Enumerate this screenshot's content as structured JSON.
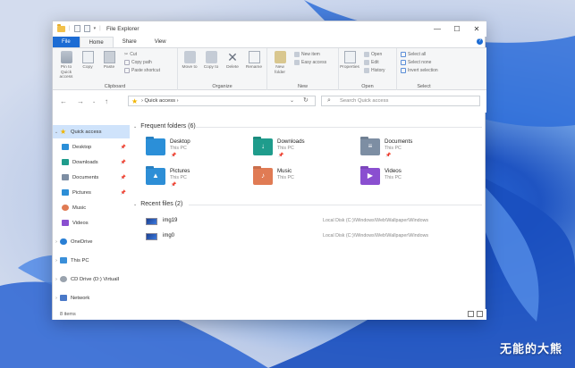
{
  "window": {
    "title": "File Explorer",
    "controls": {
      "minimize": "—",
      "maximize": "☐",
      "close": "✕"
    }
  },
  "tabs": [
    {
      "label": "File"
    },
    {
      "label": "Home"
    },
    {
      "label": "Share"
    },
    {
      "label": "View"
    }
  ],
  "help_label": "?",
  "ribbon": {
    "clipboard": {
      "label": "Clipboard",
      "pin": "Pin to Quick access",
      "copy": "Copy",
      "paste": "Paste",
      "cut": "Cut",
      "copy_path": "Copy path",
      "paste_shortcut": "Paste shortcut"
    },
    "organize": {
      "label": "Organize",
      "move_to": "Move to",
      "copy_to": "Copy to",
      "delete": "Delete",
      "rename": "Rename"
    },
    "new": {
      "label": "New",
      "new_folder": "New folder",
      "new_item": "New item",
      "easy_access": "Easy access"
    },
    "open": {
      "label": "Open",
      "properties": "Properties",
      "open": "Open",
      "edit": "Edit",
      "history": "History"
    },
    "select": {
      "label": "Select",
      "select_all": "Select all",
      "select_none": "Select none",
      "invert_selection": "Invert selection"
    }
  },
  "address": {
    "path": "Quick access",
    "search_placeholder": "Search Quick access"
  },
  "sidebar": {
    "items": [
      {
        "label": "Quick access"
      },
      {
        "label": "Desktop"
      },
      {
        "label": "Downloads"
      },
      {
        "label": "Documents"
      },
      {
        "label": "Pictures"
      },
      {
        "label": "Music"
      },
      {
        "label": "Videos"
      },
      {
        "label": "OneDrive"
      },
      {
        "label": "This PC"
      },
      {
        "label": "CD Drive (D:) VirtualI"
      },
      {
        "label": "Network"
      }
    ]
  },
  "frequent": {
    "header": "Frequent folders (6)",
    "folders": [
      {
        "name": "Desktop",
        "location": "This PC",
        "color": "#2b8fd8"
      },
      {
        "name": "Downloads",
        "location": "This PC",
        "color": "#1f9c8c"
      },
      {
        "name": "Documents",
        "location": "This PC",
        "color": "#7d8ea3"
      },
      {
        "name": "Pictures",
        "location": "This PC",
        "color": "#2d8ed6"
      },
      {
        "name": "Music",
        "location": "This PC",
        "color": "#e07b54"
      },
      {
        "name": "Videos",
        "location": "This PC",
        "color": "#8a4fd0"
      }
    ]
  },
  "recent": {
    "header": "Recent files (2)",
    "files": [
      {
        "name": "img19",
        "path": "Local Disk (C:)\\Windows\\Web\\Wallpaper\\Windows"
      },
      {
        "name": "img0",
        "path": "Local Disk (C:)\\Windows\\Web\\Wallpaper\\Windows"
      }
    ]
  },
  "status": {
    "count": "8 items"
  },
  "watermark": "无能的大熊"
}
